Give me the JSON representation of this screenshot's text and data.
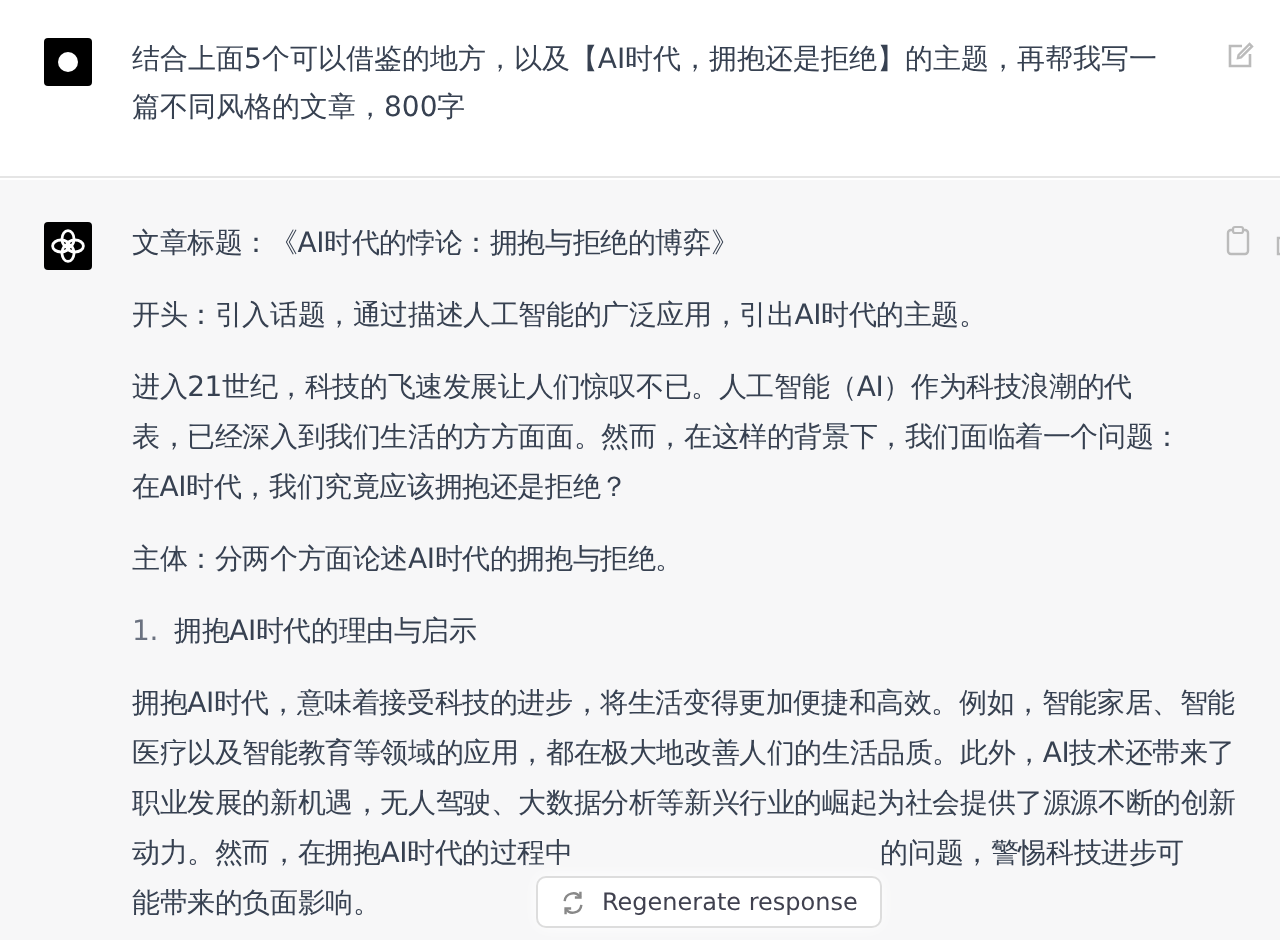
{
  "user_message": {
    "text": "结合上面5个可以借鉴的地方，以及【AI时代，拥抱还是拒绝】的主题，再帮我写一篇不同风格的文章，800字"
  },
  "assistant_message": {
    "paragraphs": [
      {
        "kind": "text",
        "text": "文章标题：《AI时代的悖论：拥抱与拒绝的博弈》"
      },
      {
        "kind": "text",
        "text": "开头：引入话题，通过描述人工智能的广泛应用，引出AI时代的主题。"
      },
      {
        "kind": "text",
        "text": "进入21世纪，科技的飞速发展让人们惊叹不已。人工智能（AI）作为科技浪潮的代表，已经深入到我们生活的方方面面。然而，在这样的背景下，我们面临着一个问题：在AI时代，我们究竟应该拥抱还是拒绝？"
      },
      {
        "kind": "text",
        "text": "主体：分两个方面论述AI时代的拥抱与拒绝。"
      },
      {
        "kind": "list_item",
        "number": "1.",
        "text": "拥抱AI时代的理由与启示"
      },
      {
        "kind": "lines",
        "lines": [
          {
            "text": "拥抱AI时代，意味着接受科技的进步，将生活变得更加便捷和高效。例如，智能家居、智能"
          },
          {
            "text": "医疗以及智能教育等领域的应用，都在极大地改善人们的生活品质。此外，AI技术还带来了"
          },
          {
            "text": "职业发展的新机遇，无人驾驶、大数据分析等新兴行业的崛起为社会提供了源源不断的创新"
          },
          {
            "text": "动力。然而，在拥抱AI时代的过程中",
            "right_text": "的问题，警惕科技进步可"
          },
          {
            "text": "能带来的负面影响。"
          }
        ]
      }
    ]
  },
  "regenerate_button": {
    "label": "Regenerate response"
  }
}
